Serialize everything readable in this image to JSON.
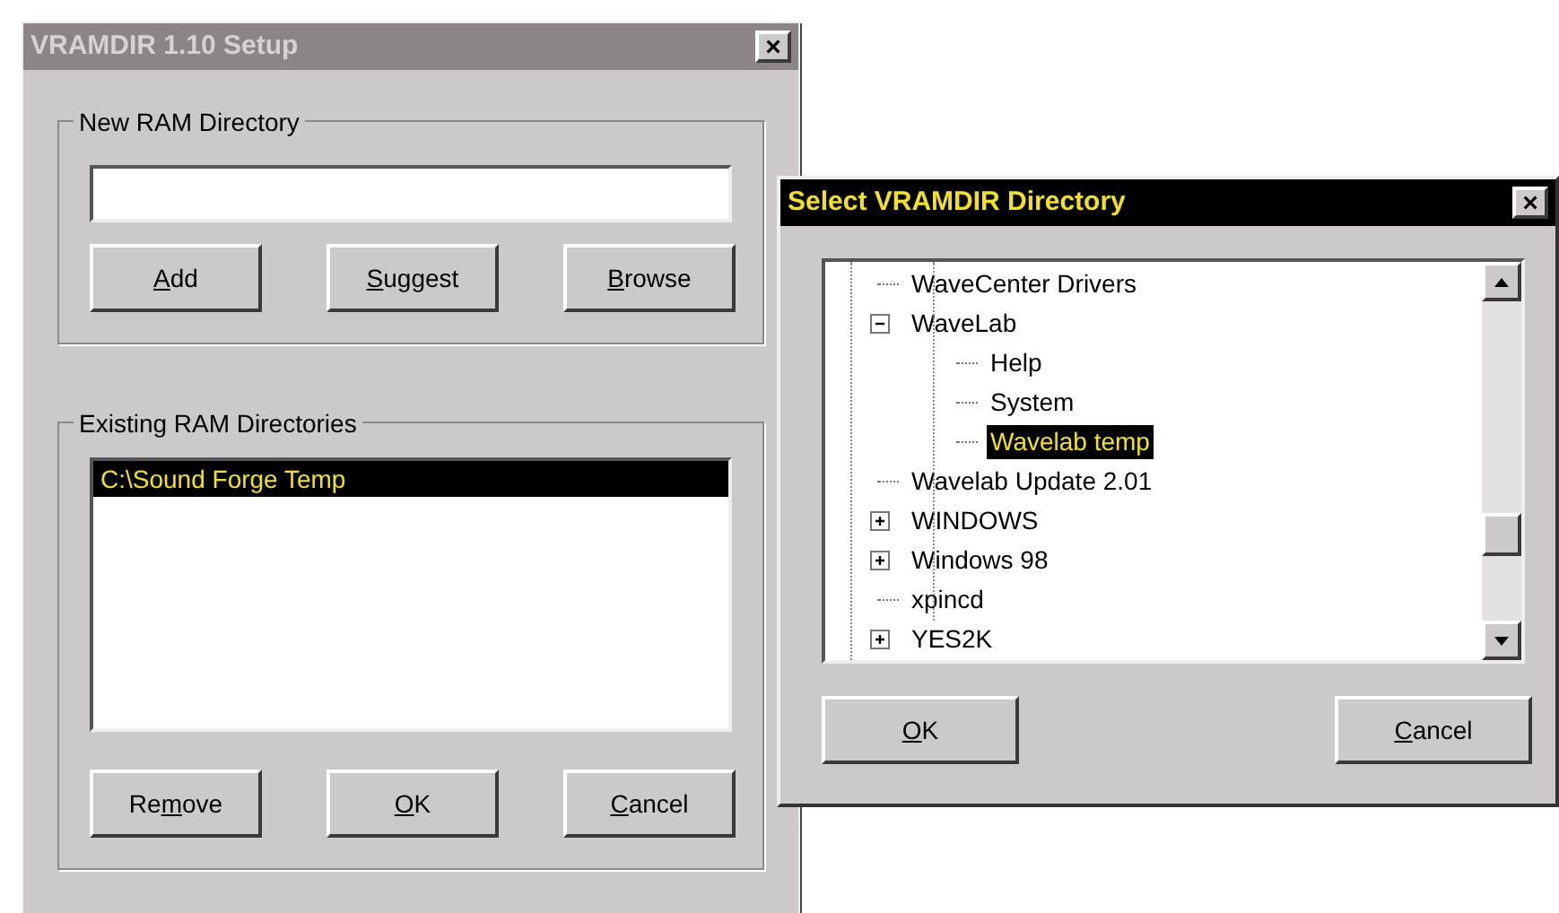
{
  "setup_window": {
    "title": "VRAMDIR 1.10 Setup",
    "active": false,
    "close": "×",
    "new_group": {
      "title": "New RAM Directory",
      "buttons": [
        {
          "key": "A",
          "after": "dd"
        },
        {
          "key": "S",
          "after": "uggest"
        },
        {
          "key": "B",
          "after": "rowse"
        }
      ]
    },
    "existing_group": {
      "title": "Existing RAM Directories",
      "items": [
        {
          "label": "C:\\Sound Forge Temp",
          "selected": true
        }
      ]
    },
    "buttons": [
      {
        "before": "Re",
        "key": "m",
        "after": "ove"
      },
      {
        "key": "O",
        "after": "K"
      },
      {
        "key": "C",
        "after": "ancel"
      }
    ]
  },
  "select_window": {
    "title": "Select VRAMDIR Directory",
    "active": true,
    "close": "×",
    "tree": [
      {
        "label": "WaveCenter Drivers",
        "kind": "leaf",
        "selected": false
      },
      {
        "label": "WaveLab",
        "kind": "folder",
        "expanded": true,
        "selected": false,
        "children": [
          {
            "label": "Help",
            "kind": "leaf",
            "selected": false
          },
          {
            "label": "System",
            "kind": "leaf",
            "selected": false
          },
          {
            "label": "Wavelab temp",
            "kind": "leaf",
            "selected": true
          }
        ]
      },
      {
        "label": "Wavelab Update 2.01",
        "kind": "leaf",
        "selected": false
      },
      {
        "label": "WINDOWS",
        "kind": "folder",
        "expanded": false,
        "selected": false
      },
      {
        "label": "Windows 98",
        "kind": "folder",
        "expanded": false,
        "selected": false
      },
      {
        "label": "xpincd",
        "kind": "leaf",
        "selected": false
      },
      {
        "label": "YES2K",
        "kind": "folder",
        "expanded": false,
        "selected": false
      }
    ],
    "buttons": [
      {
        "key": "O",
        "after": "K"
      },
      {
        "key": "C",
        "after": "ancel"
      }
    ]
  }
}
